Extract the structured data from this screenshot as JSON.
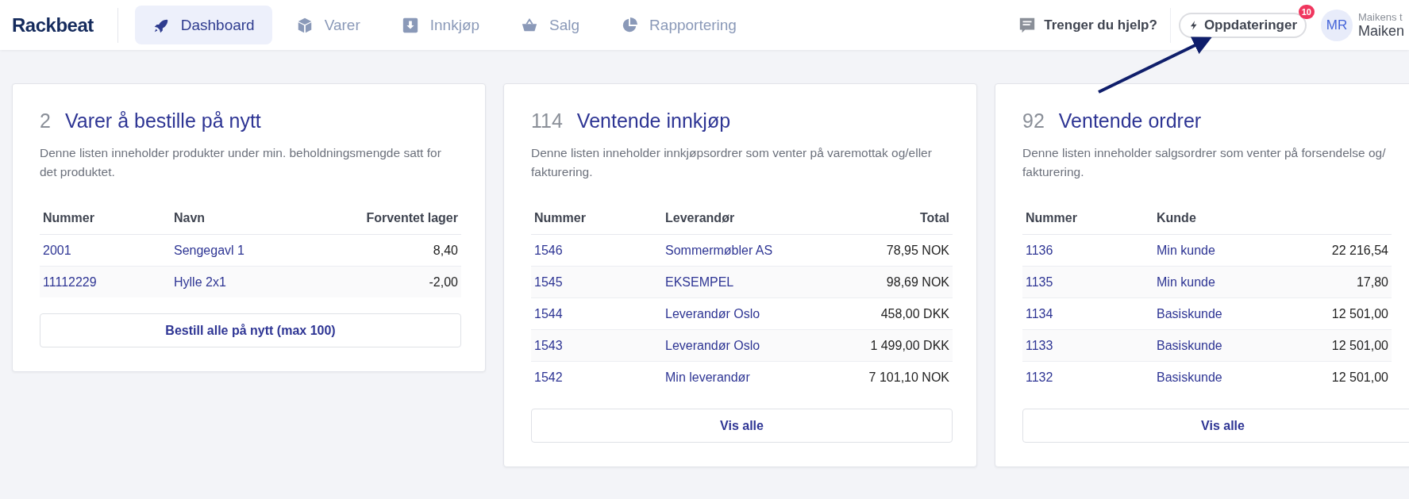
{
  "nav": {
    "logo": "Rackbeat",
    "tabs": [
      {
        "label": "Dashboard",
        "selected": true
      },
      {
        "label": "Varer",
        "selected": false
      },
      {
        "label": "Innkjøp",
        "selected": false
      },
      {
        "label": "Salg",
        "selected": false
      },
      {
        "label": "Rapportering",
        "selected": false
      }
    ],
    "help": "Trenger du hjelp?",
    "updates": {
      "label": "Oppdateringer",
      "badge": "10"
    },
    "user": {
      "initials": "MR",
      "company": "Maikens t",
      "name": "Maiken"
    }
  },
  "cards": [
    {
      "count": "2",
      "title": "Varer å bestille på nytt",
      "description": "Denne listen inneholder produkter under min. beholdningsmengde satt for det produktet.",
      "columns": [
        "Nummer",
        "Navn",
        "Forventet lager"
      ],
      "rows": [
        [
          "2001",
          "Sengegavl 1",
          "8,40"
        ],
        [
          "11112229",
          "Hylle 2x1",
          "-2,00"
        ]
      ],
      "button": "Bestill alle på nytt (max 100)"
    },
    {
      "count": "114",
      "title": "Ventende innkjøp",
      "description": "Denne listen inneholder innkjøpsordrer som venter på varemottak og/eller fakturering.",
      "columns": [
        "Nummer",
        "Leverandør",
        "Total"
      ],
      "rows": [
        [
          "1546",
          "Sommermøbler AS",
          "78,95 NOK"
        ],
        [
          "1545",
          "EKSEMPEL",
          "98,69 NOK"
        ],
        [
          "1544",
          "Leverandør Oslo",
          "458,00 DKK"
        ],
        [
          "1543",
          "Leverandør Oslo",
          "1 499,00 DKK"
        ],
        [
          "1542",
          "Min leverandør",
          "7 101,10 NOK"
        ]
      ],
      "button": "Vis alle"
    },
    {
      "count": "92",
      "title": "Ventende ordrer",
      "description": "Denne listen inneholder salgsordrer som venter på forsendelse og/ fakturering.",
      "columns": [
        "Nummer",
        "Kunde"
      ],
      "rows": [
        [
          "1136",
          "Min kunde",
          "22 216,54"
        ],
        [
          "1135",
          "Min kunde",
          "17,80"
        ],
        [
          "1134",
          "Basiskunde",
          "12 501,00"
        ],
        [
          "1133",
          "Basiskunde",
          "12 501,00"
        ],
        [
          "1132",
          "Basiskunde",
          "12 501,00"
        ]
      ],
      "button": "Vis alle"
    }
  ]
}
